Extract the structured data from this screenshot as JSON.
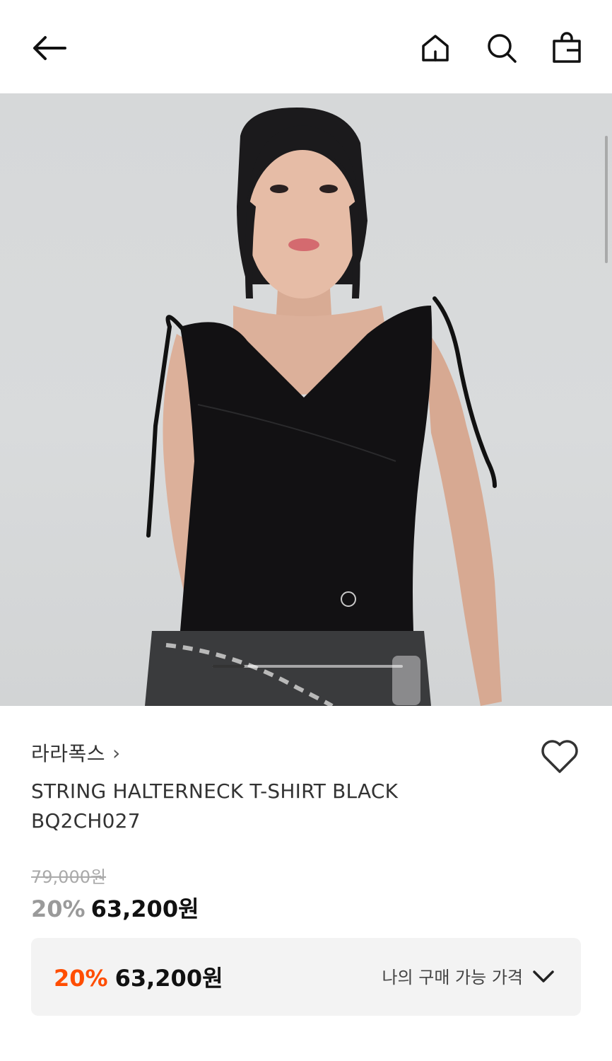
{
  "header": {
    "back_icon": "arrow-left-icon",
    "home_icon": "home-icon",
    "search_icon": "search-icon",
    "bag_icon": "shopping-bag-icon"
  },
  "gallery": {
    "current_index": 1,
    "progress_fraction": 0.17
  },
  "product": {
    "brand": "라라폭스",
    "brand_chevron": "›",
    "title": "STRING HALTERNECK T-SHIRT BLACK BQ2CH027",
    "original_price": "79,000원",
    "discount_rate": "20%",
    "sale_price": "63,200원",
    "wishlist_icon": "heart-outline-icon"
  },
  "my_price": {
    "discount_rate": "20%",
    "price": "63,200원",
    "label": "나의 구매 가능 가격",
    "expand_icon": "chevron-down-icon",
    "accent_color": "#ff4d00"
  }
}
